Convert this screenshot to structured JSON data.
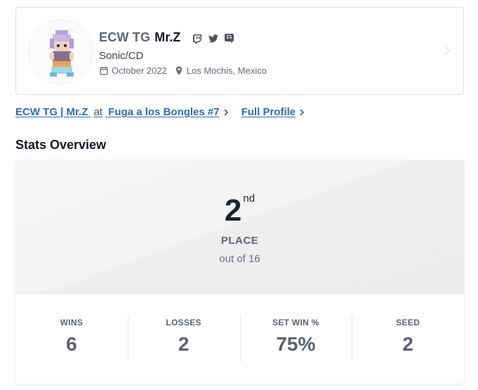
{
  "profile": {
    "prefix": "ECW TG",
    "gamertag": "Mr.Z",
    "character": "Sonic/CD",
    "joined": "October 2022",
    "location": "Los Mochis, Mexico",
    "socials": [
      "twitch-icon",
      "twitter-icon",
      "discord-icon"
    ]
  },
  "links": {
    "entrant_prefix": "ECW TG",
    "entrant_separator": "|",
    "entrant_name": "Mr.Z",
    "at_text": "at",
    "event_name": "Fuga a los Bongles #7",
    "full_profile": "Full Profile"
  },
  "stats": {
    "section_title": "Stats Overview",
    "placement_number": "2",
    "placement_suffix": "nd",
    "placement_label": "PLACE",
    "out_of": "out of 16",
    "items": [
      {
        "label": "WINS",
        "value": "6"
      },
      {
        "label": "LOSSES",
        "value": "2"
      },
      {
        "label": "SET WIN %",
        "value": "75%"
      },
      {
        "label": "SEED",
        "value": "2"
      }
    ]
  },
  "colors": {
    "link": "#2d6bb5",
    "text_muted": "#5d6572",
    "heading": "#111827"
  }
}
